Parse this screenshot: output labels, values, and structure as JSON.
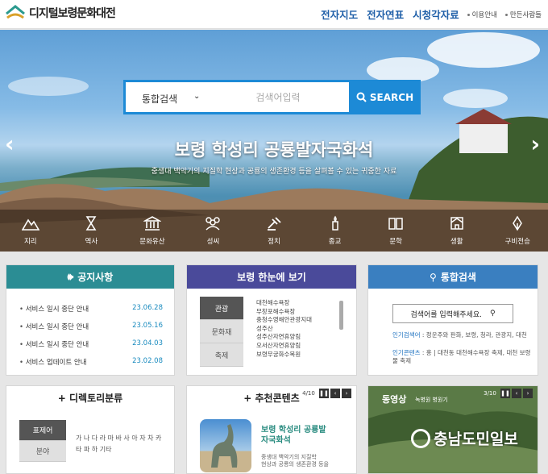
{
  "header": {
    "site_name": "디지털보령문화대전",
    "nav": [
      "전자지도",
      "전자연표",
      "시청각자료"
    ],
    "sub_links": [
      "이용안내",
      "만든사람들"
    ]
  },
  "hero": {
    "search": {
      "scope": "통합검색",
      "placeholder": "검색어입력",
      "button": "SEARCH"
    },
    "title": "보령 학성리 공룡발자국화석",
    "subtitle": "중생대 백악기의 지질학 현상과 공룡의 생존환경 등을 살펴볼 수 있는 귀중한 자료",
    "categories": [
      "지리",
      "역사",
      "문화유산",
      "성씨",
      "정치",
      "종교",
      "문학",
      "생활",
      "구비전승"
    ]
  },
  "notice": {
    "title": "공지사항",
    "items": [
      {
        "text": "서비스 일시 중단 안내",
        "date": "23.06.28"
      },
      {
        "text": "서비스 일시 중단 안내",
        "date": "23.05.16"
      },
      {
        "text": "서비스 일시 중단 안내",
        "date": "23.04.03"
      },
      {
        "text": "서비스 업데이트 안내",
        "date": "23.02.08"
      }
    ]
  },
  "glance": {
    "title": "보령 한눈에 보기",
    "tabs": [
      "관광",
      "문화재",
      "축제"
    ],
    "items": [
      "대천해수욕장",
      "무창포해수욕장",
      "충청수영해안관광지대",
      "성주산",
      "성주산자연휴양림",
      "오서산자연휴양림",
      "보령무궁화수목원"
    ]
  },
  "integrated": {
    "title": "통합검색",
    "input_placeholder": "검색어를 입력해주세요.",
    "related_search_label": "인기검색어",
    "related_search_text": "정운주와 판화, 보령, 청라, 관광지, 대천",
    "related_content_label": "인기콘텐츠",
    "related_content_text": "홍 | 대천동 대천해수욕장 축제, 대천 보령",
    "related_content_text2": "물 축제"
  },
  "directory": {
    "title": "디렉토리분류",
    "tabs": [
      "표제어",
      "분야"
    ],
    "letters_row1": "가 나 다 라 마 바 사 아 자 차 카",
    "letters_row2": "타 파 하 기타"
  },
  "recommend": {
    "title": "추천콘텐츠",
    "pager": "4/10",
    "item_title1": "보령 학성리 공룡발",
    "item_title2": "자국화석",
    "item_desc1": "중생대 백악기의 지질학",
    "item_desc2": "현상과 공룡의 생존환경 등을"
  },
  "video": {
    "title": "동영상",
    "caption": "녹병원 병원기",
    "pager": "3/10"
  },
  "watermark": "충남도민일보",
  "colors": {
    "accent": "#1d8ad6",
    "notice": "#2b8d94",
    "glance": "#4a4a9a",
    "search": "#3a7fc0"
  }
}
